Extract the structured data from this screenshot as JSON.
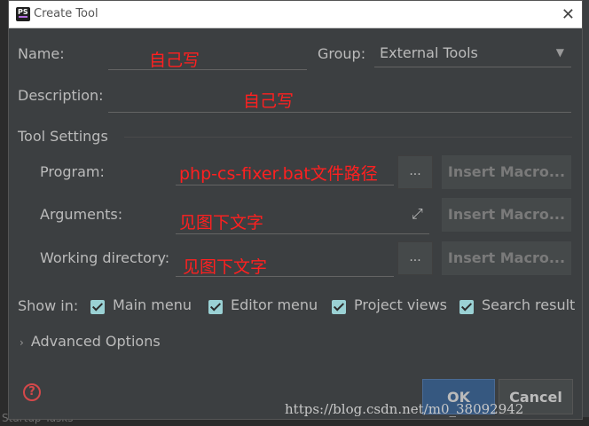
{
  "dialog": {
    "title": "Create Tool",
    "app_icon_text": "PS"
  },
  "form": {
    "name_label": "Name:",
    "name_value": "自己写",
    "group_label": "Group:",
    "group_value": "External Tools",
    "description_label": "Description:",
    "description_value": "自己写"
  },
  "tool_settings": {
    "section_title": "Tool Settings",
    "program_label": "Program:",
    "program_value": "php-cs-fixer.bat文件路径",
    "arguments_label": "Arguments:",
    "arguments_value": "见图下文字",
    "working_dir_label": "Working directory:",
    "working_dir_value": "见图下文字",
    "browse_label": "...",
    "insert_macro_label": "Insert Macro..."
  },
  "show_in": {
    "label": "Show in:",
    "options": [
      {
        "label": "Main menu",
        "checked": true
      },
      {
        "label": "Editor menu",
        "checked": true
      },
      {
        "label": "Project views",
        "checked": true
      },
      {
        "label": "Search result",
        "checked": true
      }
    ]
  },
  "advanced_label": "Advanced Options",
  "buttons": {
    "ok": "OK",
    "cancel": "Cancel",
    "help": "?"
  },
  "background": {
    "bottom_text": "Startup Tasks"
  },
  "watermark": "https://blog.csdn.net/m0_38092942"
}
